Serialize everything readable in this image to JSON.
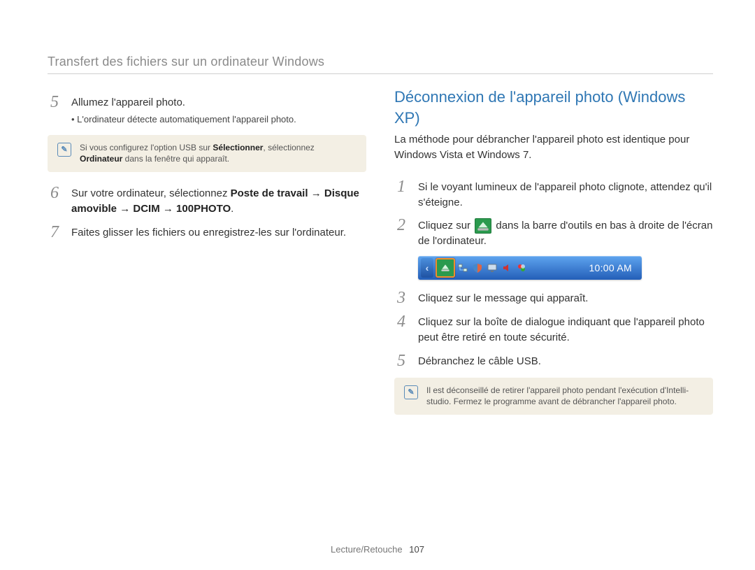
{
  "header": {
    "title": "Transfert des fichiers sur un ordinateur Windows"
  },
  "left": {
    "step5": {
      "num": "5",
      "text": "Allumez l'appareil photo.",
      "sub": "L'ordinateur détecte automatiquement l'appareil photo."
    },
    "note1": {
      "pre": "Si vous configurez l'option USB sur ",
      "bold1": "Sélectionner",
      "mid": ", sélectionnez ",
      "bold2": "Ordinateur",
      "post": " dans la fenêtre qui apparaît."
    },
    "step6": {
      "num": "6",
      "pre": "Sur votre ordinateur, sélectionnez ",
      "b1": "Poste de travail",
      "arrow": "→",
      "b2": "Disque amovible",
      "b3": "DCIM",
      "b4": "100PHOTO",
      "dot": "."
    },
    "step7": {
      "num": "7",
      "text": "Faites glisser les fichiers ou enregistrez-les sur l'ordinateur."
    }
  },
  "right": {
    "title": "Déconnexion de l'appareil photo (Windows XP)",
    "intro": "La méthode pour débrancher l'appareil photo est identique pour Windows Vista et Windows 7.",
    "step1": {
      "num": "1",
      "text": "Si le voyant lumineux de l'appareil photo clignote, attendez qu'il s'éteigne."
    },
    "step2": {
      "num": "2",
      "pre": "Cliquez sur ",
      "post": " dans la barre d'outils en bas à droite de l'écran de l'ordinateur."
    },
    "taskbar": {
      "clock": "10:00 AM"
    },
    "step3": {
      "num": "3",
      "text": "Cliquez sur le message qui apparaît."
    },
    "step4": {
      "num": "4",
      "text": "Cliquez sur la boîte de dialogue indiquant que l'appareil photo peut être retiré en toute sécurité."
    },
    "step5": {
      "num": "5",
      "text": "Débranchez le câble USB."
    },
    "note2": "Il est déconseillé de retirer l'appareil photo pendant l'exécution d'Intelli-studio. Fermez le programme avant de débrancher l'appareil photo."
  },
  "footer": {
    "section": "Lecture/Retouche",
    "page": "107"
  }
}
